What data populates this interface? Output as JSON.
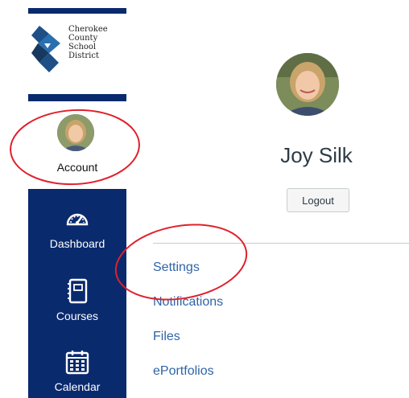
{
  "sidebar": {
    "logo": {
      "lines": [
        "Cherokee",
        "County",
        "School",
        "District"
      ]
    },
    "account": {
      "label": "Account"
    },
    "items": [
      {
        "label": "Dashboard",
        "icon": "dashboard-gauge-icon"
      },
      {
        "label": "Courses",
        "icon": "courses-book-icon"
      },
      {
        "label": "Calendar",
        "icon": "calendar-icon"
      }
    ],
    "colors": {
      "nav_bg": "#0a2a6e",
      "nav_text": "#ffffff"
    }
  },
  "profile": {
    "name": "Joy Silk",
    "logout_label": "Logout"
  },
  "profile_links": [
    {
      "label": "Settings"
    },
    {
      "label": "Notifications"
    },
    {
      "label": "Files"
    },
    {
      "label": "ePortfolios"
    }
  ],
  "colors": {
    "link": "#2f64a8",
    "annotation": "#e0202b"
  }
}
